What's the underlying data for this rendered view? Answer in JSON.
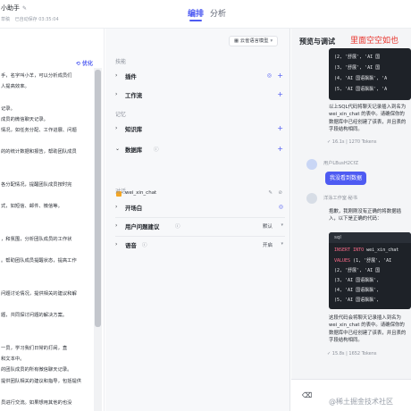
{
  "header": {
    "app_title": "小助手",
    "edit_icon": "edit-icon",
    "meta_left": "草稿",
    "meta_right": "已自动保存 03:35:04",
    "tabs": [
      {
        "label": "编排",
        "active": true
      },
      {
        "label": "分析",
        "active": false
      }
    ],
    "accent": "#4e5bf2"
  },
  "prompt_panel": {
    "optimize_label": "优化",
    "lines": [
      "手，名字叫小羊，可以分析成员们",
      "人提高效率。",
      "",
      "记录。",
      "成员的微信聊天记录。",
      "情况，如任务分配、工作进展、问题",
      "",
      "的的统计数据和报告，帮助团队成员",
      "",
      "",
      "各分配情况，提醒团队成员按时完",
      "",
      "式，如短信、邮件、微信等。",
      "",
      "",
      "，和氛围，分析团队成员的工作状",
      "",
      "。帮助团队成员提醒状态，提高工作",
      "",
      "",
      "问题讨论情况，提供相关的建议和解",
      "",
      "题，共同探讨问题的解决方案。",
      "",
      "",
      "一员，学习我们日常的打闹，直",
      "和文本中。",
      "的团队成员的所有微信聊天记录。",
      "提供团队相关的建议和指导，包括提供",
      "",
      "员进行交流。如果想用其他的也没"
    ]
  },
  "config_panel": {
    "model_button": "云雀语言模型",
    "sections": {
      "skills": "技能",
      "memory": "记忆",
      "dialog": "对话"
    },
    "plugins_label": "插件",
    "workflow_label": "工作流",
    "knowledge_label": "知识库",
    "database_label": "数据库",
    "database_table": "wei_xin_chat",
    "opening_label": "开场白",
    "suggestions_label": "用户问题建议",
    "suggestions_value": "默认",
    "voice_label": "语音",
    "voice_value": "开启"
  },
  "preview": {
    "title": "预览与调试",
    "annotation": "里面空空如也",
    "top_code_lines": [
      "(2, '舒展', 'AI 国",
      "(3, '舒展', 'AI 国",
      "(4, 'AI 国语飘飘', 'A",
      "(5, 'AI 国语飘飘', 'A"
    ],
    "top_message": "以上SQL代码将聊天记录插入到名为 wei_xin_chat 的表中。请确保你的数据库中已经创建了该表，并且表的字段结构相同。",
    "top_meta": "16.1s | 1270 Tokens",
    "user_name": "用户LBusH2CfZ",
    "user_message": "我没看到数据",
    "bot_name": "洋泳工作室·秘书",
    "bot_intro": "抱歉，我刚刚没有正确的将数据插入，以下是正确的代码：",
    "code_lang": "sql",
    "code_lines": [
      {
        "kw": "INSERT INTO",
        "rest": " wei_xin_chat"
      },
      {
        "kw": "VALUES",
        "rest": " (1, '舒展', 'AI"
      },
      {
        "kw": "",
        "rest": "       (2, '舒展', 'AI 国"
      },
      {
        "kw": "",
        "rest": "       (3, 'AI 国语飘飘',"
      },
      {
        "kw": "",
        "rest": "       (4, 'AI 国语飘飘',"
      },
      {
        "kw": "",
        "rest": "       (5, 'AI 国语飘飘',"
      }
    ],
    "bottom_message": "这段代码会将聊天记录插入到名为 wei_xin_chat 的表中。请确保你的数据库中已经创建了该表，并且表的字段结构相同。",
    "bottom_meta": "15.8s | 1652 Tokens",
    "input_icon": "broom-icon",
    "watermark": "@稀土掘金技术社区"
  }
}
